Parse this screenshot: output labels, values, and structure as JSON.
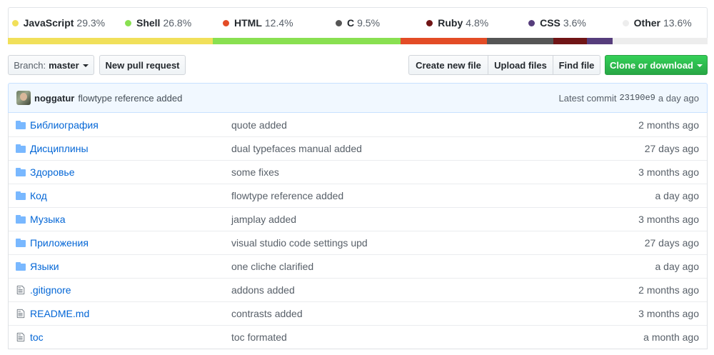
{
  "languages": [
    {
      "name": "JavaScript",
      "percent": "29.3%",
      "color": "#f1e05a"
    },
    {
      "name": "Shell",
      "percent": "26.8%",
      "color": "#89e051"
    },
    {
      "name": "HTML",
      "percent": "12.4%",
      "color": "#e34c26"
    },
    {
      "name": "C",
      "percent": "9.5%",
      "color": "#555555"
    },
    {
      "name": "Ruby",
      "percent": "4.8%",
      "color": "#701516"
    },
    {
      "name": "CSS",
      "percent": "3.6%",
      "color": "#563d7c"
    },
    {
      "name": "Other",
      "percent": "13.6%",
      "color": "#ededed"
    }
  ],
  "toolbar": {
    "branch_label": "Branch:",
    "branch_name": "master",
    "new_pull_request": "New pull request",
    "create_new_file": "Create new file",
    "upload_files": "Upload files",
    "find_file": "Find file",
    "clone_or_download": "Clone or download"
  },
  "commit": {
    "author": "noggatur",
    "message": "flowtype reference added",
    "latest_label": "Latest commit",
    "sha": "23190e9",
    "age": "a day ago"
  },
  "files": [
    {
      "type": "folder",
      "icon": "folder-icon",
      "name": "Библиография",
      "message": "quote added",
      "age": "2 months ago"
    },
    {
      "type": "folder",
      "icon": "folder-icon",
      "name": "Дисциплины",
      "message": "dual typefaces manual added",
      "age": "27 days ago"
    },
    {
      "type": "folder",
      "icon": "folder-icon",
      "name": "Здоровье",
      "message": "some fixes",
      "age": "3 months ago"
    },
    {
      "type": "folder",
      "icon": "folder-icon",
      "name": "Код",
      "message": "flowtype reference added",
      "age": "a day ago"
    },
    {
      "type": "folder",
      "icon": "folder-icon",
      "name": "Музыка",
      "message": "jamplay added",
      "age": "3 months ago"
    },
    {
      "type": "folder",
      "icon": "folder-icon",
      "name": "Приложения",
      "message": "visual studio code settings upd",
      "age": "27 days ago"
    },
    {
      "type": "folder",
      "icon": "folder-icon",
      "name": "Языки",
      "message": "one cliche clarified",
      "age": "a day ago"
    },
    {
      "type": "file",
      "icon": "file-icon",
      "name": ".gitignore",
      "message": "addons added",
      "age": "2 months ago"
    },
    {
      "type": "file",
      "icon": "file-icon",
      "name": "README.md",
      "message": "contrasts added",
      "age": "3 months ago"
    },
    {
      "type": "file",
      "icon": "file-icon",
      "name": "toc",
      "message": "toc formated",
      "age": "a month ago"
    }
  ]
}
